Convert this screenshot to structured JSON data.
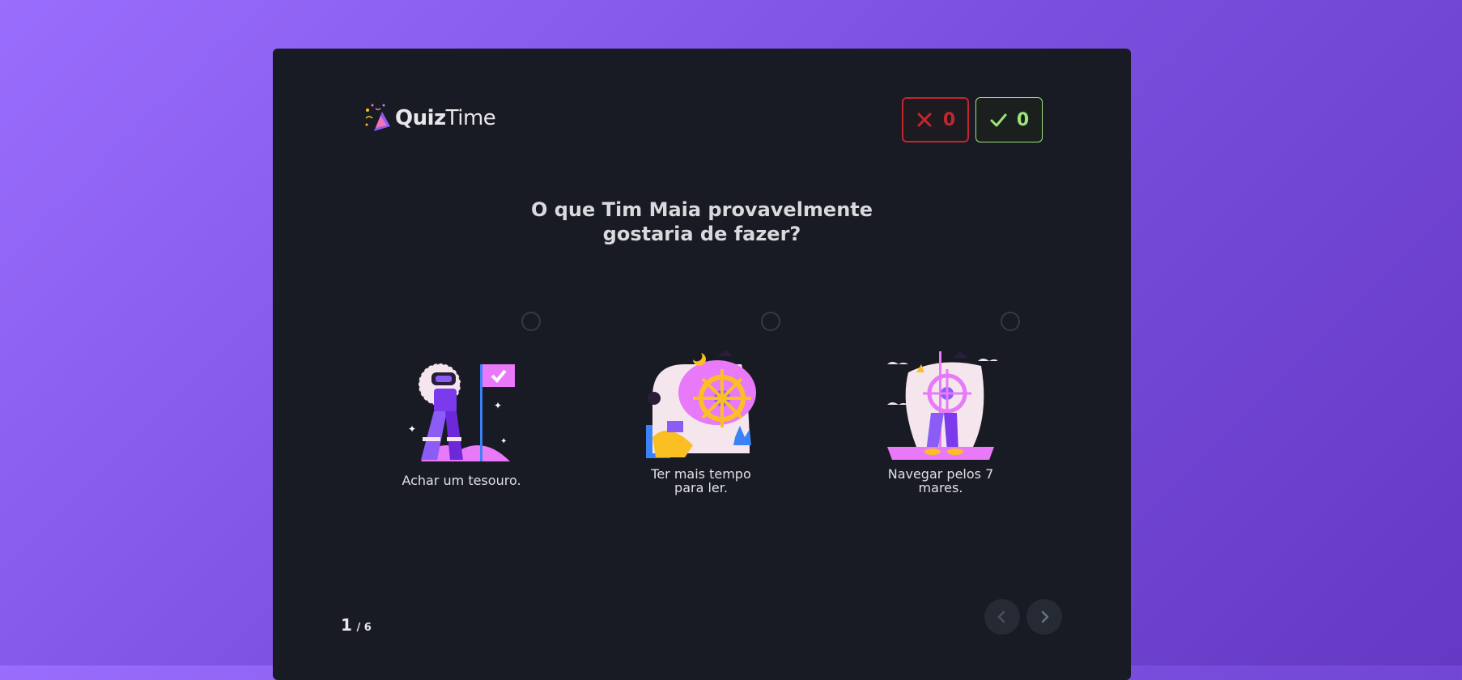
{
  "logo": {
    "part1": "Quiz",
    "part2": "Time"
  },
  "scores": {
    "wrong_count": "0",
    "right_count": "0"
  },
  "question": {
    "line1": "O que Tim Maia provavelmente",
    "line2": "gostaria de fazer?"
  },
  "options": [
    {
      "label": "Achar um tesouro.",
      "icon": "astronaut-flag-illustration"
    },
    {
      "label": "Ter mais tempo para ler.",
      "icon": "reading-pirate-dream-illustration"
    },
    {
      "label": "Navegar pelos 7 mares.",
      "icon": "pirate-ship-wheel-illustration"
    }
  ],
  "pager": {
    "current": "1",
    "total": "/ 6"
  },
  "colors": {
    "card": "#181b23",
    "wrong": "#c3262d",
    "right": "#9be37a",
    "accent": "#8b5cf6"
  }
}
